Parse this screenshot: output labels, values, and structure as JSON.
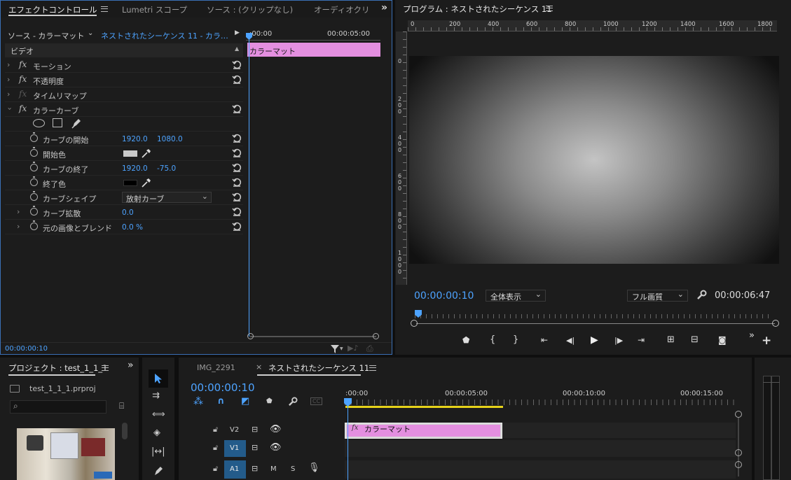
{
  "effect_controls": {
    "tabs": [
      "エフェクトコントロール",
      "Lumetri スコープ",
      "ソース : (クリップなし)",
      "オーディオクリ"
    ],
    "source_label": "ソース - カラーマット",
    "sequence_link": "ネストされたシーケンス 11 - カラ…",
    "section_video": "ビデオ",
    "time_start": ":00:00",
    "time_end": "00:00:05:00",
    "clip_name": "カラーマット",
    "effects": [
      {
        "name": "モーション"
      },
      {
        "name": "不透明度"
      },
      {
        "name": "タイムリマップ"
      },
      {
        "name": "カラーカーブ"
      }
    ],
    "params": [
      {
        "name": "カーブの開始",
        "v1": "1920.0",
        "v2": "1080.0"
      },
      {
        "name": "開始色"
      },
      {
        "name": "カーブの終了",
        "v1": "1920.0",
        "v2": "-75.0"
      },
      {
        "name": "終了色"
      },
      {
        "name": "カーブシェイプ",
        "dropdown": "放射カーブ"
      },
      {
        "name": "カーブ拡散",
        "v1": "0.0"
      },
      {
        "name": "元の画像とブレンド",
        "v1": "0.0 %"
      }
    ],
    "footer_time": "00:00:00:10",
    "colors": {
      "clip": "#e48fe0",
      "start_color": "#c8c8c8",
      "end_color": "#000000",
      "accent": "#4da3ff"
    }
  },
  "program": {
    "title": "プログラム : ネストされたシーケンス 11",
    "ruler_labels": [
      "0",
      "200",
      "400",
      "600",
      "800",
      "1000",
      "1200",
      "1400",
      "1600",
      "1800"
    ],
    "vruler_labels": [
      "0",
      "200",
      "400",
      "600",
      "800",
      "1000"
    ],
    "timecode": "00:00:00:10",
    "zoom": "全体表示",
    "quality": "フル画質",
    "duration": "00:00:06:47"
  },
  "project": {
    "title": "プロジェクト : test_1_1_1",
    "file": "test_1_1_1.prproj"
  },
  "timeline": {
    "tabs": [
      "IMG_2291",
      "ネストされたシーケンス 11"
    ],
    "timecode": "00:00:00:10",
    "ruler_labels": [
      ":00:00",
      "00:00:05:00",
      "00:00:10:00",
      "00:00:15:00"
    ],
    "tracks": [
      {
        "name": "V2",
        "type": "video"
      },
      {
        "name": "V1",
        "type": "video"
      },
      {
        "name": "A1",
        "type": "audio",
        "m": "M",
        "s": "S"
      }
    ],
    "clip_name": "カラーマット",
    "cc_label": "CC"
  }
}
